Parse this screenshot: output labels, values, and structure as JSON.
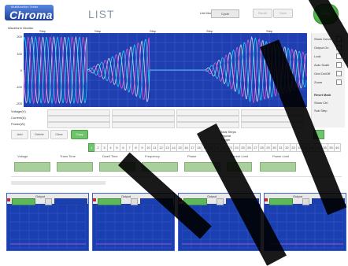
{
  "header": {
    "logo_tagline": "Multifunction Tester",
    "logo_text": "Chroma",
    "page_title": "LIST",
    "field_label": "List Mode Select",
    "field_value": "Cycle",
    "button_left": "Recall",
    "button_right": "Save",
    "reset_label": "Reset"
  },
  "waveform": {
    "section_label": "Waveform Monitor",
    "columns": [
      "Step",
      "Step",
      "Step",
      "Step",
      "Step"
    ],
    "y_labels": [
      "200",
      "100",
      "0",
      "-100",
      "-200"
    ],
    "series_colors": [
      "#e6e6e6",
      "#ff57d9",
      "#20e0ff"
    ]
  },
  "right_panel": {
    "labels": [
      "Show Curve",
      "Output On",
      "Lock",
      "Auto Scale",
      "Grid On/Off",
      "Zoom"
    ],
    "footer": [
      "Reset Mark",
      "Show Ctrl",
      "Sub Step"
    ]
  },
  "stats": {
    "rows": [
      "Voltage(V)",
      "Current(A)",
      "Power(W)"
    ],
    "values": [
      "0.0",
      "0.0",
      "0.0",
      "0.0"
    ]
  },
  "list_ctrl": {
    "buttons": [
      "Add",
      "Delete",
      "Clear",
      "Copy"
    ],
    "step_numbers": [
      "1",
      "2",
      "3",
      "4",
      "5",
      "6",
      "7",
      "8",
      "9",
      "10",
      "11",
      "12",
      "13",
      "14",
      "15",
      "16",
      "17",
      "18",
      "19",
      "20",
      "21",
      "22",
      "23",
      "24",
      "25",
      "26",
      "27",
      "28",
      "29",
      "30",
      "31",
      "32",
      "33",
      "34",
      "35",
      "36",
      "37",
      "38",
      "39",
      "40"
    ],
    "selected_step": "1",
    "param_labels": [
      "Voltage",
      "Trans Time",
      "Dwell Time",
      "Frequency",
      "Phase",
      "Current Limit",
      "Power Limit"
    ],
    "summary_labels": [
      "Total Steps",
      "Repeat",
      "Trigger"
    ]
  },
  "mini_panels": [
    {
      "name": "Output"
    },
    {
      "name": "Output"
    },
    {
      "name": "Output"
    },
    {
      "name": "Output"
    }
  ]
}
